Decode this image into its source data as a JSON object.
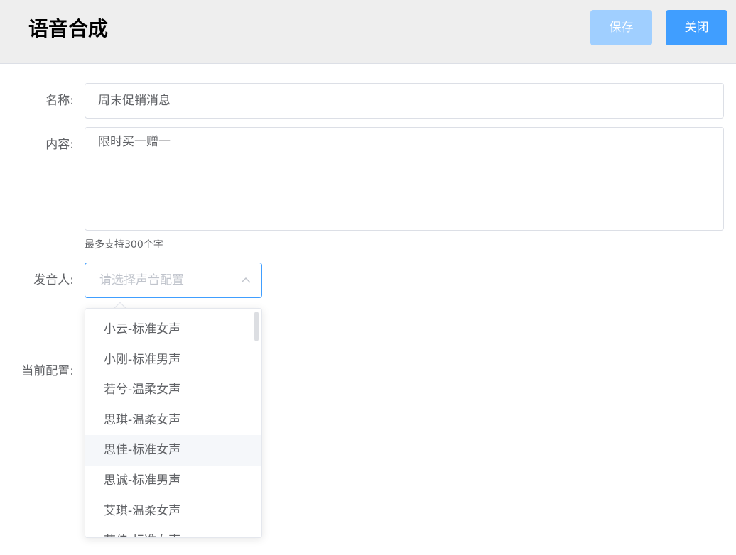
{
  "header": {
    "title": "语音合成",
    "save_label": "保存",
    "close_label": "关闭"
  },
  "form": {
    "name_label": "名称:",
    "name_value": "周末促销消息",
    "content_label": "内容:",
    "content_value": "限时买一赠一",
    "content_hint": "最多支持300个字",
    "speaker_label": "发音人:",
    "speaker_placeholder": "请选择声音配置",
    "current_config_label": "当前配置:"
  },
  "dropdown": {
    "items": [
      "小云-标准女声",
      "小刚-标准男声",
      "若兮-温柔女声",
      "思琪-温柔女声",
      "思佳-标准女声",
      "思诚-标准男声",
      "艾琪-温柔女声",
      "艾佳-标准女声"
    ],
    "hover_index": 4
  },
  "colors": {
    "primary": "#409eff",
    "primary_disabled": "#a0cfff",
    "header_bg": "#eeeeee"
  }
}
